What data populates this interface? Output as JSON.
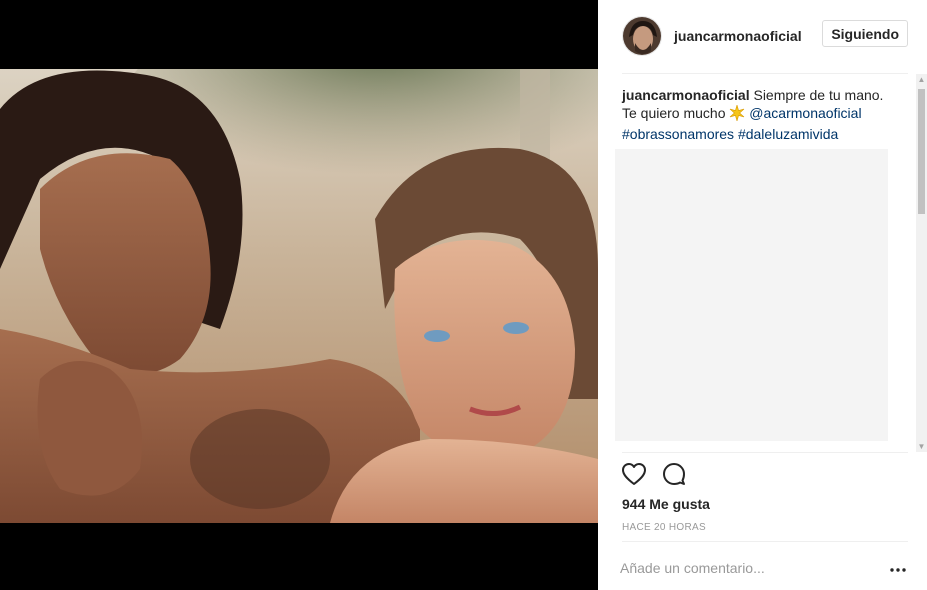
{
  "post": {
    "username": "juancarmonaoficial",
    "follow_button": "Siguiendo",
    "caption": {
      "username": "juancarmonaoficial",
      "text_line1": "Siempre de tu mano.",
      "text_line2": "Te quiero mucho",
      "mention": "@acarmonaoficial",
      "hashtag1": "#obrassonamores",
      "hashtag2": "#daleluzamivida"
    },
    "likes": "944 Me gusta",
    "timestamp": "HACE 20 HORAS",
    "comment_placeholder": "Añade un comentario..."
  },
  "colors": {
    "text": "#262626",
    "link": "#003569",
    "muted": "#999999",
    "border": "#dbdbdb"
  },
  "icons": {
    "like": "heart-icon",
    "comment": "comment-bubble-icon",
    "more": "more-options-icon",
    "sparkle": "sparkle-emoji-icon"
  }
}
